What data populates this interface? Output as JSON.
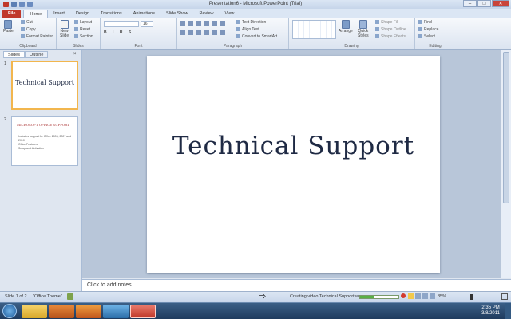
{
  "window": {
    "title": "Presentation6 - Microsoft PowerPoint (Trial)",
    "controls": [
      "–",
      "□",
      "✕"
    ]
  },
  "ribbon_tabs": [
    "File",
    "Home",
    "Insert",
    "Design",
    "Transitions",
    "Animations",
    "Slide Show",
    "Review",
    "View"
  ],
  "clipboard": {
    "paste": "Paste",
    "cut": "Cut",
    "copy": "Copy",
    "format_painter": "Format Painter",
    "label": "Clipboard"
  },
  "slides_group": {
    "new_slide_line1": "New",
    "new_slide_line2": "Slide",
    "layout": "Layout",
    "reset": "Reset",
    "section": "Section",
    "label": "Slides"
  },
  "font_group": {
    "size": "16",
    "label": "Font"
  },
  "paragraph_group": {
    "text_direction": "Text Direction",
    "align_text": "Align Text",
    "convert_smartart": "Convert to SmartArt",
    "label": "Paragraph"
  },
  "drawing_group": {
    "arrange": "Arrange",
    "quick_styles_line1": "Quick",
    "quick_styles_line2": "Styles",
    "shape_fill": "Shape Fill",
    "shape_outline": "Shape Outline",
    "shape_effects": "Shape Effects",
    "label": "Drawing"
  },
  "editing_group": {
    "find": "Find",
    "replace": "Replace",
    "select": "Select",
    "label": "Editing"
  },
  "panel_tabs": [
    "Slides",
    "Outline"
  ],
  "thumbnails": [
    {
      "number": "1",
      "title": "Technical Support"
    },
    {
      "number": "2",
      "title": "MICROSOFT OFFICE SUPPORT",
      "bullets": [
        "Includes support for Office 2003, 2007 and 2010",
        "Office Features",
        "Setup and Activation"
      ]
    }
  ],
  "slide": {
    "title": "Technical Support"
  },
  "notes": {
    "placeholder": "Click to add notes"
  },
  "status": {
    "slide_info": "Slide 1 of 2",
    "theme": "\"Office Theme\"",
    "creating_video": "Creating video Technical Support.wmv",
    "progress": 0.35,
    "zoom": "85%"
  },
  "taskbar": {
    "time": "2:35 PM",
    "date": "3/8/2011"
  }
}
